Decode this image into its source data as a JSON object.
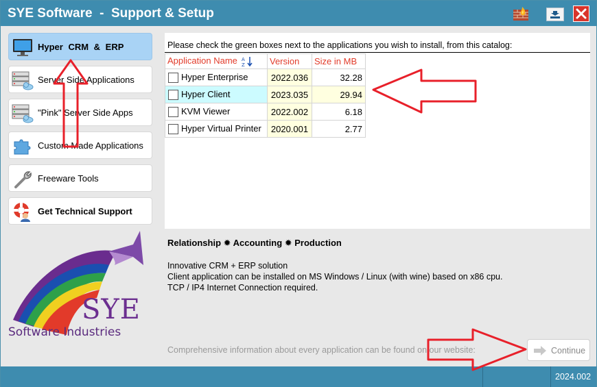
{
  "window": {
    "title": "SYE Software  -  Support & Setup",
    "icons": {
      "firewall": "firewall-icon",
      "minimize": "minimize-icon",
      "close": "close-icon"
    }
  },
  "sidebar": {
    "items": [
      {
        "label": "Hyper  CRM  &  ERP",
        "icon": "monitor-icon",
        "active": true
      },
      {
        "label": "Server Side Applications",
        "icon": "server-cloud-icon"
      },
      {
        "label": "\"Pink\" Server Side Apps",
        "icon": "server-cloud-icon"
      },
      {
        "label": "Custom Made Applications",
        "icon": "puzzle-icon"
      },
      {
        "label": "Freeware Tools",
        "icon": "wrench-icon"
      },
      {
        "label": "Get Technical Support",
        "icon": "lifebuoy-support-icon"
      }
    ]
  },
  "logo": {
    "name": "SYE",
    "subtitle": "Software Industries"
  },
  "catalog": {
    "instruction": "Please check the green boxes next to the applications you wish to install, from this catalog:",
    "columns": [
      "Application Name",
      "Version",
      "Size in MB"
    ],
    "rows": [
      {
        "name": "Hyper Enterprise",
        "version": "2022.036",
        "size": "32.28",
        "highlighted": false
      },
      {
        "name": "Hyper Client",
        "version": "2023.035",
        "size": "29.94",
        "highlighted": true
      },
      {
        "name": "KVM Viewer",
        "version": "2022.002",
        "size": "6.18",
        "highlighted": false
      },
      {
        "name": "Hyper Virtual Printer",
        "version": "2020.001",
        "size": "2.77",
        "highlighted": false
      }
    ]
  },
  "description": {
    "title": "Relationship ✹ Accounting ✹ Production",
    "lines": [
      "Innovative CRM + ERP solution",
      "Client application can be installed on MS Windows / Linux (with wine) based on x86 cpu.",
      "TCP / IP4  Internet Connection required."
    ]
  },
  "footer": {
    "info": "Comprehensive information about every application can be found on our website:",
    "continue_label": "Continue"
  },
  "status": {
    "version": "2024.002"
  },
  "colors": {
    "accent": "#3e8caf",
    "header_text": "#e23b2a",
    "annotation": "#e8202a",
    "active_nav": "#a9d3f5"
  }
}
